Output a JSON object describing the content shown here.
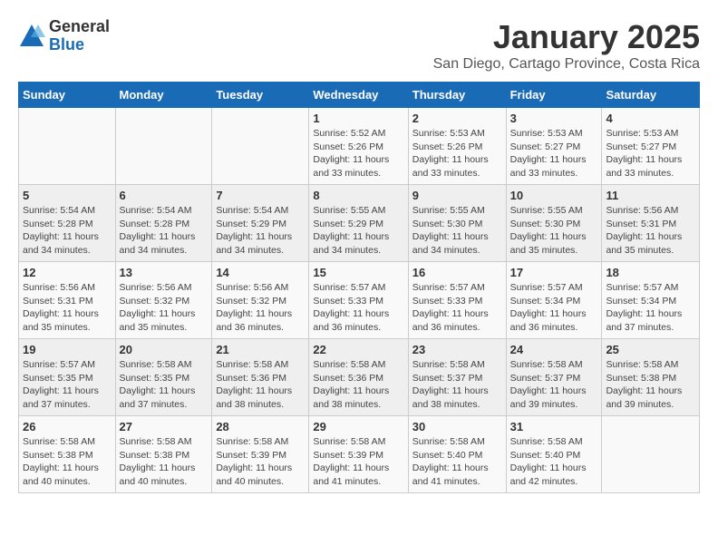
{
  "header": {
    "logo_general": "General",
    "logo_blue": "Blue",
    "month_title": "January 2025",
    "subtitle": "San Diego, Cartago Province, Costa Rica"
  },
  "weekdays": [
    "Sunday",
    "Monday",
    "Tuesday",
    "Wednesday",
    "Thursday",
    "Friday",
    "Saturday"
  ],
  "weeks": [
    [
      {
        "day": "",
        "info": ""
      },
      {
        "day": "",
        "info": ""
      },
      {
        "day": "",
        "info": ""
      },
      {
        "day": "1",
        "info": "Sunrise: 5:52 AM\nSunset: 5:26 PM\nDaylight: 11 hours and 33 minutes."
      },
      {
        "day": "2",
        "info": "Sunrise: 5:53 AM\nSunset: 5:26 PM\nDaylight: 11 hours and 33 minutes."
      },
      {
        "day": "3",
        "info": "Sunrise: 5:53 AM\nSunset: 5:27 PM\nDaylight: 11 hours and 33 minutes."
      },
      {
        "day": "4",
        "info": "Sunrise: 5:53 AM\nSunset: 5:27 PM\nDaylight: 11 hours and 33 minutes."
      }
    ],
    [
      {
        "day": "5",
        "info": "Sunrise: 5:54 AM\nSunset: 5:28 PM\nDaylight: 11 hours and 34 minutes."
      },
      {
        "day": "6",
        "info": "Sunrise: 5:54 AM\nSunset: 5:28 PM\nDaylight: 11 hours and 34 minutes."
      },
      {
        "day": "7",
        "info": "Sunrise: 5:54 AM\nSunset: 5:29 PM\nDaylight: 11 hours and 34 minutes."
      },
      {
        "day": "8",
        "info": "Sunrise: 5:55 AM\nSunset: 5:29 PM\nDaylight: 11 hours and 34 minutes."
      },
      {
        "day": "9",
        "info": "Sunrise: 5:55 AM\nSunset: 5:30 PM\nDaylight: 11 hours and 34 minutes."
      },
      {
        "day": "10",
        "info": "Sunrise: 5:55 AM\nSunset: 5:30 PM\nDaylight: 11 hours and 35 minutes."
      },
      {
        "day": "11",
        "info": "Sunrise: 5:56 AM\nSunset: 5:31 PM\nDaylight: 11 hours and 35 minutes."
      }
    ],
    [
      {
        "day": "12",
        "info": "Sunrise: 5:56 AM\nSunset: 5:31 PM\nDaylight: 11 hours and 35 minutes."
      },
      {
        "day": "13",
        "info": "Sunrise: 5:56 AM\nSunset: 5:32 PM\nDaylight: 11 hours and 35 minutes."
      },
      {
        "day": "14",
        "info": "Sunrise: 5:56 AM\nSunset: 5:32 PM\nDaylight: 11 hours and 36 minutes."
      },
      {
        "day": "15",
        "info": "Sunrise: 5:57 AM\nSunset: 5:33 PM\nDaylight: 11 hours and 36 minutes."
      },
      {
        "day": "16",
        "info": "Sunrise: 5:57 AM\nSunset: 5:33 PM\nDaylight: 11 hours and 36 minutes."
      },
      {
        "day": "17",
        "info": "Sunrise: 5:57 AM\nSunset: 5:34 PM\nDaylight: 11 hours and 36 minutes."
      },
      {
        "day": "18",
        "info": "Sunrise: 5:57 AM\nSunset: 5:34 PM\nDaylight: 11 hours and 37 minutes."
      }
    ],
    [
      {
        "day": "19",
        "info": "Sunrise: 5:57 AM\nSunset: 5:35 PM\nDaylight: 11 hours and 37 minutes."
      },
      {
        "day": "20",
        "info": "Sunrise: 5:58 AM\nSunset: 5:35 PM\nDaylight: 11 hours and 37 minutes."
      },
      {
        "day": "21",
        "info": "Sunrise: 5:58 AM\nSunset: 5:36 PM\nDaylight: 11 hours and 38 minutes."
      },
      {
        "day": "22",
        "info": "Sunrise: 5:58 AM\nSunset: 5:36 PM\nDaylight: 11 hours and 38 minutes."
      },
      {
        "day": "23",
        "info": "Sunrise: 5:58 AM\nSunset: 5:37 PM\nDaylight: 11 hours and 38 minutes."
      },
      {
        "day": "24",
        "info": "Sunrise: 5:58 AM\nSunset: 5:37 PM\nDaylight: 11 hours and 39 minutes."
      },
      {
        "day": "25",
        "info": "Sunrise: 5:58 AM\nSunset: 5:38 PM\nDaylight: 11 hours and 39 minutes."
      }
    ],
    [
      {
        "day": "26",
        "info": "Sunrise: 5:58 AM\nSunset: 5:38 PM\nDaylight: 11 hours and 40 minutes."
      },
      {
        "day": "27",
        "info": "Sunrise: 5:58 AM\nSunset: 5:38 PM\nDaylight: 11 hours and 40 minutes."
      },
      {
        "day": "28",
        "info": "Sunrise: 5:58 AM\nSunset: 5:39 PM\nDaylight: 11 hours and 40 minutes."
      },
      {
        "day": "29",
        "info": "Sunrise: 5:58 AM\nSunset: 5:39 PM\nDaylight: 11 hours and 41 minutes."
      },
      {
        "day": "30",
        "info": "Sunrise: 5:58 AM\nSunset: 5:40 PM\nDaylight: 11 hours and 41 minutes."
      },
      {
        "day": "31",
        "info": "Sunrise: 5:58 AM\nSunset: 5:40 PM\nDaylight: 11 hours and 42 minutes."
      },
      {
        "day": "",
        "info": ""
      }
    ]
  ]
}
